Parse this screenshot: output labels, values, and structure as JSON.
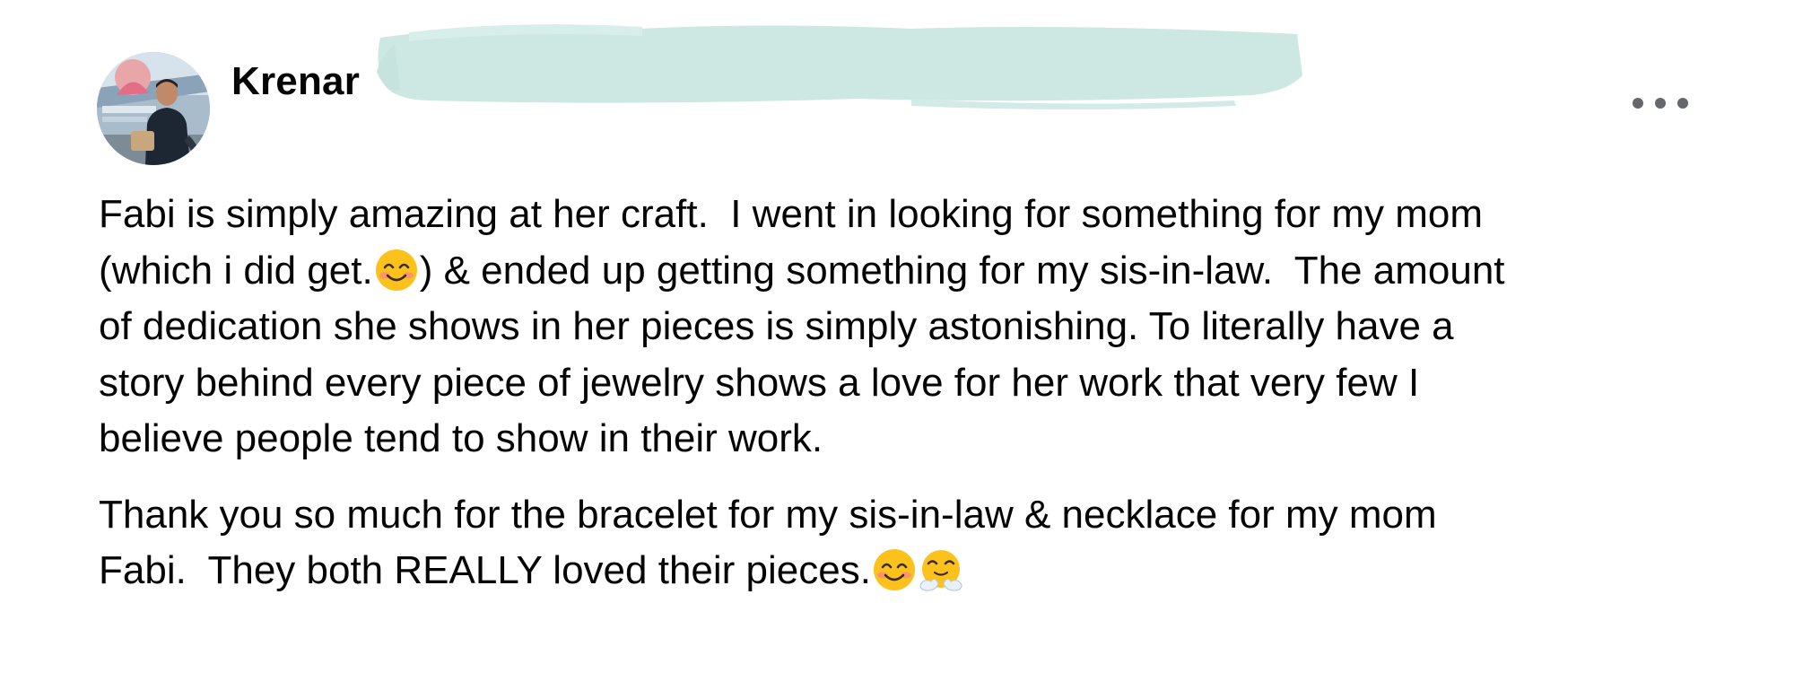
{
  "post": {
    "author": {
      "name": "Krenar"
    },
    "menu_icon": "more-horizontal-icon",
    "paragraphs": [
      {
        "lines": [
          [
            {
              "type": "text",
              "text": "Fabi is simply amazing at her craft.  I went in looking for something for my mom"
            }
          ],
          [
            {
              "type": "text",
              "text": "(which i did get."
            },
            {
              "type": "emoji",
              "name": "smiling-face-with-smiling-eyes-emoji"
            },
            {
              "type": "text",
              "text": ") & ended up getting something for my sis-in-law.  The amount"
            }
          ],
          [
            {
              "type": "text",
              "text": "of dedication she shows in her pieces is simply astonishing. To literally have a"
            }
          ],
          [
            {
              "type": "text",
              "text": "story behind every piece of jewelry shows a love for her work that very few I"
            }
          ],
          [
            {
              "type": "text",
              "text": "believe people tend to show in their work."
            }
          ]
        ]
      },
      {
        "lines": [
          [
            {
              "type": "text",
              "text": "Thank you so much for the bracelet for my sis-in-law & necklace for my mom"
            }
          ],
          [
            {
              "type": "text",
              "text": "Fabi.  They both REALLY loved their pieces."
            },
            {
              "type": "emoji",
              "name": "smiling-face-with-smiling-eyes-emoji"
            },
            {
              "type": "emoji",
              "name": "face-with-steam-from-nose-emoji"
            }
          ]
        ]
      }
    ],
    "colors": {
      "text": "#050505",
      "icon": "#65676b",
      "redaction": "#cde7e2",
      "emoji_face": "#fcc21b"
    }
  }
}
